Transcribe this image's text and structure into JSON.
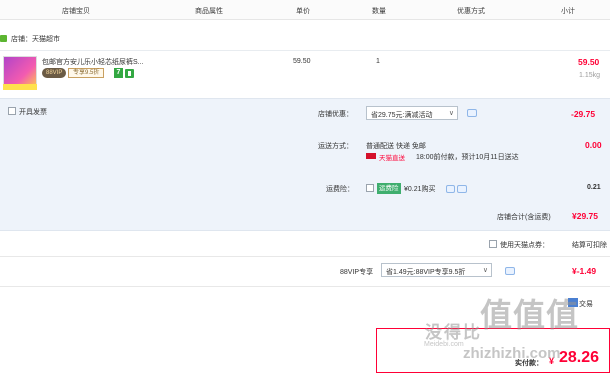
{
  "header": {
    "col_item": "店铺宝贝",
    "col_attr": "商品属性",
    "col_price": "单价",
    "col_qty": "数量",
    "col_promo": "优惠方式",
    "col_subtotal": "小计"
  },
  "store": {
    "name": "店铺：天猫超市"
  },
  "item": {
    "title": "包邮官方安儿乐小轻芯纸尿裤S...",
    "vip_badge": "88VIP",
    "vip_discount": "专享9.5折",
    "seven_day_label": "7",
    "unit_price": "59.50",
    "quantity": "1",
    "subtotal": "59.50",
    "weight": "1.15kg"
  },
  "invoice": {
    "label": "开具发票"
  },
  "store_promo": {
    "label": "店铺优惠：",
    "selected": "省29.75元:满减活动",
    "amount": "-29.75"
  },
  "shipping": {
    "label": "运送方式：",
    "method": "普通配送 快递 免邮",
    "tag": "天猫直送",
    "eta": "18:00前付款，预计10月11日送达",
    "amount": "0.00"
  },
  "insurance": {
    "label": "运费险：",
    "tag": "运费险",
    "price_text": "¥0.21购买",
    "amount": "0.21"
  },
  "store_total": {
    "label": "店铺合计(含运费)",
    "amount": "¥29.75"
  },
  "points": {
    "label": "使用天猫点券：",
    "right_label": "结算可扣除"
  },
  "vip": {
    "label": "88VIP专享",
    "selected": "省1.49元:88VIP专享9.5折",
    "amount": "¥-1.49"
  },
  "footer": {
    "pay_label": "实付款：",
    "currency": "¥",
    "amount": "28.26",
    "partial_text": "交易"
  },
  "watermark": {
    "line1": "没得比",
    "line2": "值值值",
    "url": "Meidebi.com",
    "site": "zhizhizhi.com"
  },
  "colors": {
    "accent_red": "#ff0036",
    "panel_blue": "#eef3fa",
    "tmall_green": "#33a842"
  }
}
